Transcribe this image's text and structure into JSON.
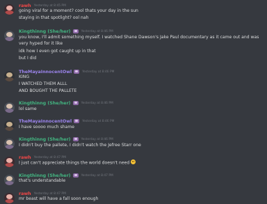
{
  "messages": [
    {
      "username": "rawh",
      "color": "#f04747",
      "avatar": "rawh",
      "badge": false,
      "timestamp": "Yesterday at 8:45 PM",
      "lines": [
        "going viral for a moment? cool thats your day in the sun",
        "staying in that spotlight? ool nah"
      ]
    },
    {
      "username": "Kingthinng (She/her)",
      "color": "#43b581",
      "avatar": "king",
      "badge": true,
      "timestamp": "Yesterday at 8:46 PM",
      "lines": [
        "you know, I'll admit something myself. I watched Shane Dawson's Jake Paul documentary as it came out and was very hyped for it like",
        "idk how I even got caught up in that",
        "but I did"
      ]
    },
    {
      "username": "TheMayaInnocentOwl",
      "color": "#9b84ec",
      "avatar": "maya",
      "badge": true,
      "timestamp": "Yesterday at 8:46 PM",
      "lines": [
        "KING",
        "I WATCHED THEM ALLL",
        "AND BOUGHT THE PALLETE"
      ]
    },
    {
      "username": "Kingthinng (She/her)",
      "color": "#43b581",
      "avatar": "king",
      "badge": true,
      "timestamp": "Yesterday at 8:46 PM",
      "lines": [
        "lol same"
      ]
    },
    {
      "username": "TheMayaInnocentOwl",
      "color": "#9b84ec",
      "avatar": "maya",
      "badge": true,
      "timestamp": "Yesterday at 8:46 PM",
      "lines": [
        "I have soooo much shame"
      ]
    },
    {
      "username": "Kingthinng (She/her)",
      "color": "#43b581",
      "avatar": "king",
      "badge": true,
      "timestamp": "Yesterday at 8:46 PM",
      "lines": [
        "I didn't buy the pallete, I didn't watch the Jefree Starr one"
      ]
    },
    {
      "username": "rawh",
      "color": "#f04747",
      "avatar": "rawh",
      "badge": false,
      "timestamp": "Yesterday at 8:47 PM",
      "lines": [
        "I just can't appreciate things the world doesn't need"
      ],
      "emoji": "slightly-smiling-face-icon"
    },
    {
      "username": "Kingthinng (She/her)",
      "color": "#43b581",
      "avatar": "king",
      "badge": true,
      "timestamp": "Yesterday at 8:47 PM",
      "lines": [
        "that's understandable"
      ]
    },
    {
      "username": "rawh",
      "color": "#f04747",
      "avatar": "rawh",
      "badge": false,
      "timestamp": "Yesterday at 8:47 PM",
      "lines": [
        "mr beast will have a fall soon enough"
      ]
    }
  ]
}
